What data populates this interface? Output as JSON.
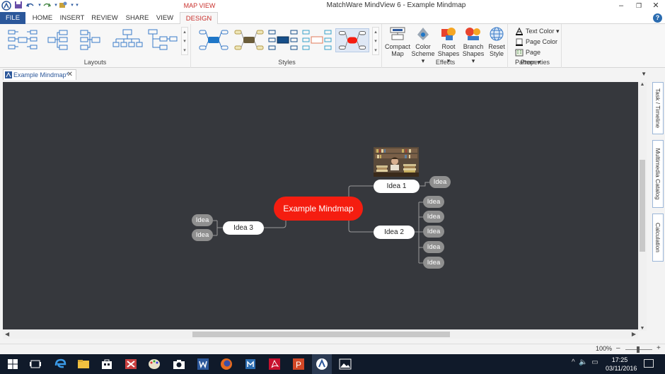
{
  "window": {
    "title": "MatchWare MindView 6 - Example Mindmap",
    "contextual_tab": "MAP VIEW"
  },
  "tabs": {
    "file": "FILE",
    "home": "HOME",
    "insert": "INSERT",
    "review": "REVIEW",
    "share": "SHARE",
    "view": "VIEW",
    "design": "DESIGN",
    "help": "?"
  },
  "ribbon": {
    "layouts_label": "Layouts",
    "styles_label": "Styles",
    "effects_label": "Effects",
    "properties_label": "Properties",
    "compact_map": "Compact Map",
    "color_scheme": "Color Scheme",
    "root_shapes": "Root Shapes",
    "branch_shapes": "Branch Shapes",
    "reset_style": "Reset Style",
    "text_color": "Text Color",
    "page_color": "Page Color",
    "page_pattern": "Page Pattern"
  },
  "document": {
    "tab_label": "Example Mindmap*"
  },
  "side_panes": [
    "Task / Timeline",
    "Multimedia Catalog",
    "Calculation"
  ],
  "mindmap": {
    "central": "Example Mindmap",
    "idea1": "Idea 1",
    "idea2": "Idea 2",
    "idea3": "Idea 3",
    "sub": "Idea"
  },
  "status": {
    "zoom": "100%"
  },
  "taskbar": {
    "time": "17:25",
    "date": "03/11/2016"
  },
  "colors": {
    "accent": "#2b579a",
    "central_node": "#f51d10",
    "canvas_bg": "#36383d",
    "subnode": "#8f8f8f"
  }
}
